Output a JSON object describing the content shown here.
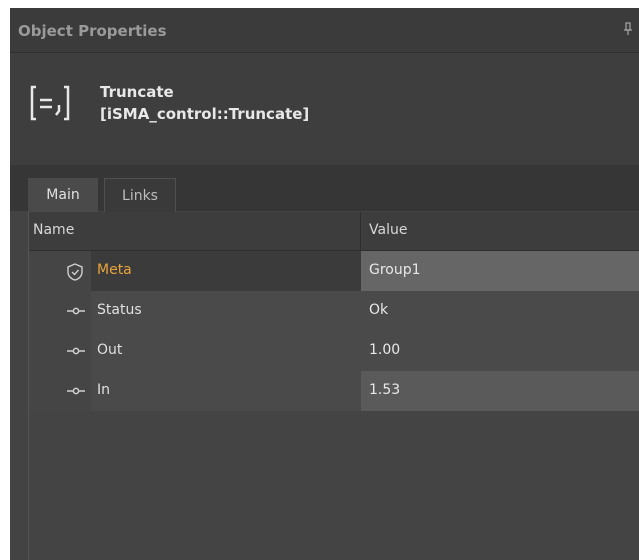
{
  "panel": {
    "title": "Object Properties",
    "pin_icon": "pin-icon"
  },
  "component": {
    "icon": "truncate-icon",
    "name": "Truncate",
    "type": "[iSMA_control::Truncate]"
  },
  "tabs": [
    {
      "label": "Main",
      "active": true
    },
    {
      "label": "Links",
      "active": false
    }
  ],
  "table": {
    "columns": [
      "Name",
      "Value"
    ],
    "rows": [
      {
        "icon": "shield-icon",
        "name": "Meta",
        "value": "Group1"
      },
      {
        "icon": "slot-icon",
        "name": "Status",
        "value": "Ok"
      },
      {
        "icon": "slot-icon",
        "name": "Out",
        "value": "1.00"
      },
      {
        "icon": "slot-icon",
        "name": "In",
        "value": "1.53"
      }
    ]
  },
  "colors": {
    "accent": "#e8a43a",
    "panel_bg": "#434343"
  }
}
